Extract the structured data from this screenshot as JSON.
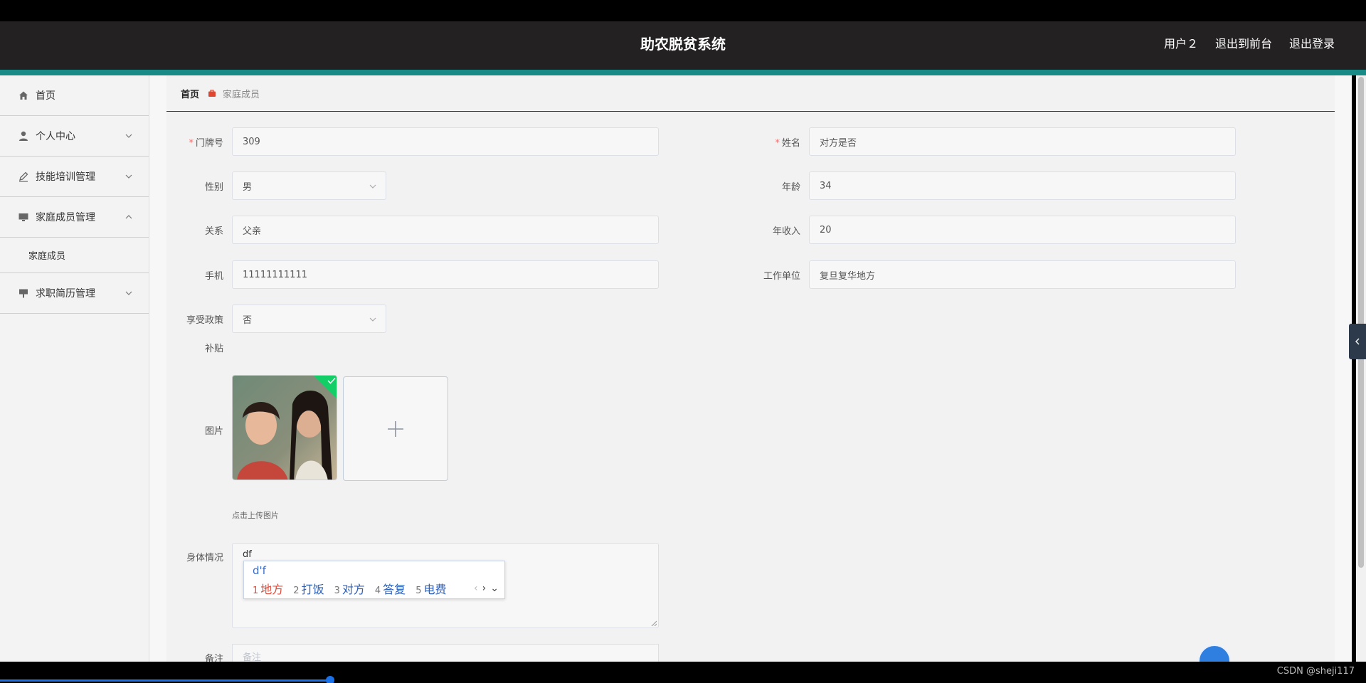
{
  "app": {
    "title": "助农脱贫系统"
  },
  "header": {
    "links": [
      "用户２",
      "退出到前台",
      "退出登录"
    ]
  },
  "sidebar": {
    "items": [
      {
        "label": "首页",
        "icon": "home-icon"
      },
      {
        "label": "个人中心",
        "icon": "user-icon"
      },
      {
        "label": "技能培训管理",
        "icon": "pen-icon"
      },
      {
        "label": "家庭成员管理",
        "icon": "monitor-icon",
        "expanded": true,
        "children": [
          "家庭成员"
        ]
      },
      {
        "label": "求职简历管理",
        "icon": "board-icon"
      }
    ]
  },
  "breadcrumb": {
    "home": "首页",
    "current": "家庭成员"
  },
  "form": {
    "doorplate": {
      "label": "门牌号",
      "value": "309",
      "required": true
    },
    "name": {
      "label": "姓名",
      "value": "对方是否",
      "required": true
    },
    "gender": {
      "label": "性别",
      "value": "男"
    },
    "age": {
      "label": "年龄",
      "value": "34"
    },
    "relation": {
      "label": "关系",
      "value": "父亲"
    },
    "income": {
      "label": "年收入",
      "value": "20"
    },
    "phone": {
      "label": "手机",
      "value": "11111111111"
    },
    "workplace": {
      "label": "工作单位",
      "value": "复旦复华地方"
    },
    "policy": {
      "label": "享受政策",
      "value": "否"
    },
    "subsidy": {
      "label": "补贴"
    },
    "picture": {
      "label": "图片",
      "hint": "点击上传图片"
    },
    "health": {
      "label": "身体情况",
      "value": "df"
    },
    "remark": {
      "label": "备注",
      "placeholder": "备注"
    }
  },
  "ime": {
    "composition": "d'f",
    "candidates": [
      {
        "n": "1",
        "text": "地方"
      },
      {
        "n": "2",
        "text": "打饭"
      },
      {
        "n": "3",
        "text": "对方"
      },
      {
        "n": "4",
        "text": "答复"
      },
      {
        "n": "5",
        "text": "电费"
      }
    ]
  },
  "watermark": "CSDN @sheji117",
  "colors": {
    "header": "#232122",
    "accent": "#1a8a86",
    "required": "#f56c6c"
  }
}
